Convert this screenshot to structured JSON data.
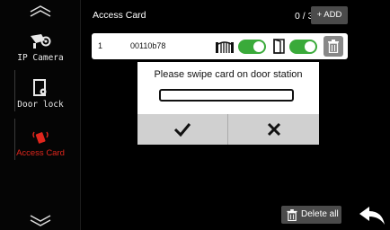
{
  "sidebar": {
    "items": [
      {
        "label": "IP Camera",
        "icon": "camera-icon",
        "active": false
      },
      {
        "label": "Door lock",
        "icon": "door-lock-icon",
        "active": false
      },
      {
        "label": "Access Card",
        "icon": "access-card-icon",
        "active": true
      }
    ],
    "scroll_up_icon": "chevron-up-icon",
    "scroll_down_icon": "chevron-down-icon"
  },
  "header": {
    "title": "Access Card",
    "count": "0 / 30",
    "add_label": "+ ADD"
  },
  "cards": [
    {
      "index": "1",
      "card_id": "00110b78",
      "gate_enabled": true,
      "door_enabled": true
    }
  ],
  "dialog": {
    "message": "Please swipe card on door station",
    "confirm_icon": "checkmark-icon",
    "cancel_icon": "x-icon"
  },
  "footer": {
    "delete_all_label": "Delete all",
    "back_icon": "back-arrow-icon"
  },
  "colors": {
    "background": "#000000",
    "active": "#e0261d",
    "toggle_on": "#3aaa3a",
    "button_bg": "#4b4b4b"
  }
}
